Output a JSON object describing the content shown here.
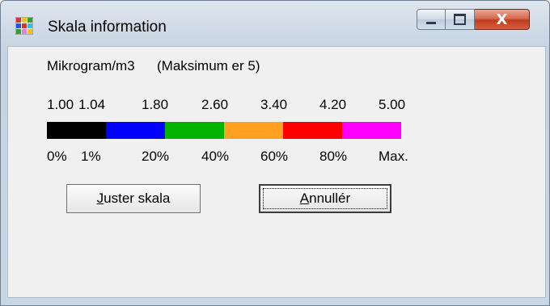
{
  "window": {
    "title": "Skala information",
    "icon": "app-grid-icon",
    "controls": {
      "minimize": "minimize-icon",
      "maximize": "maximize-icon",
      "close": "close-icon"
    }
  },
  "unit_line": {
    "unit": "Mikrogram/m3",
    "max_note": "(Maksimum er   5)"
  },
  "scale": {
    "values": [
      "1.00",
      "1.04",
      "1.80",
      "2.60",
      "3.40",
      "4.20",
      "5.00"
    ],
    "percent_labels": [
      "0%",
      "1%",
      "20%",
      "40%",
      "60%",
      "80%",
      "Max."
    ],
    "colors": [
      "#000000",
      "#0000ff",
      "#00b400",
      "#ffa020",
      "#ff0000",
      "#ff00ff"
    ]
  },
  "buttons": {
    "adjust": {
      "label_first": "J",
      "label_rest": "uster skala"
    },
    "cancel": {
      "label_first": "A",
      "label_rest": "nnullér"
    }
  }
}
